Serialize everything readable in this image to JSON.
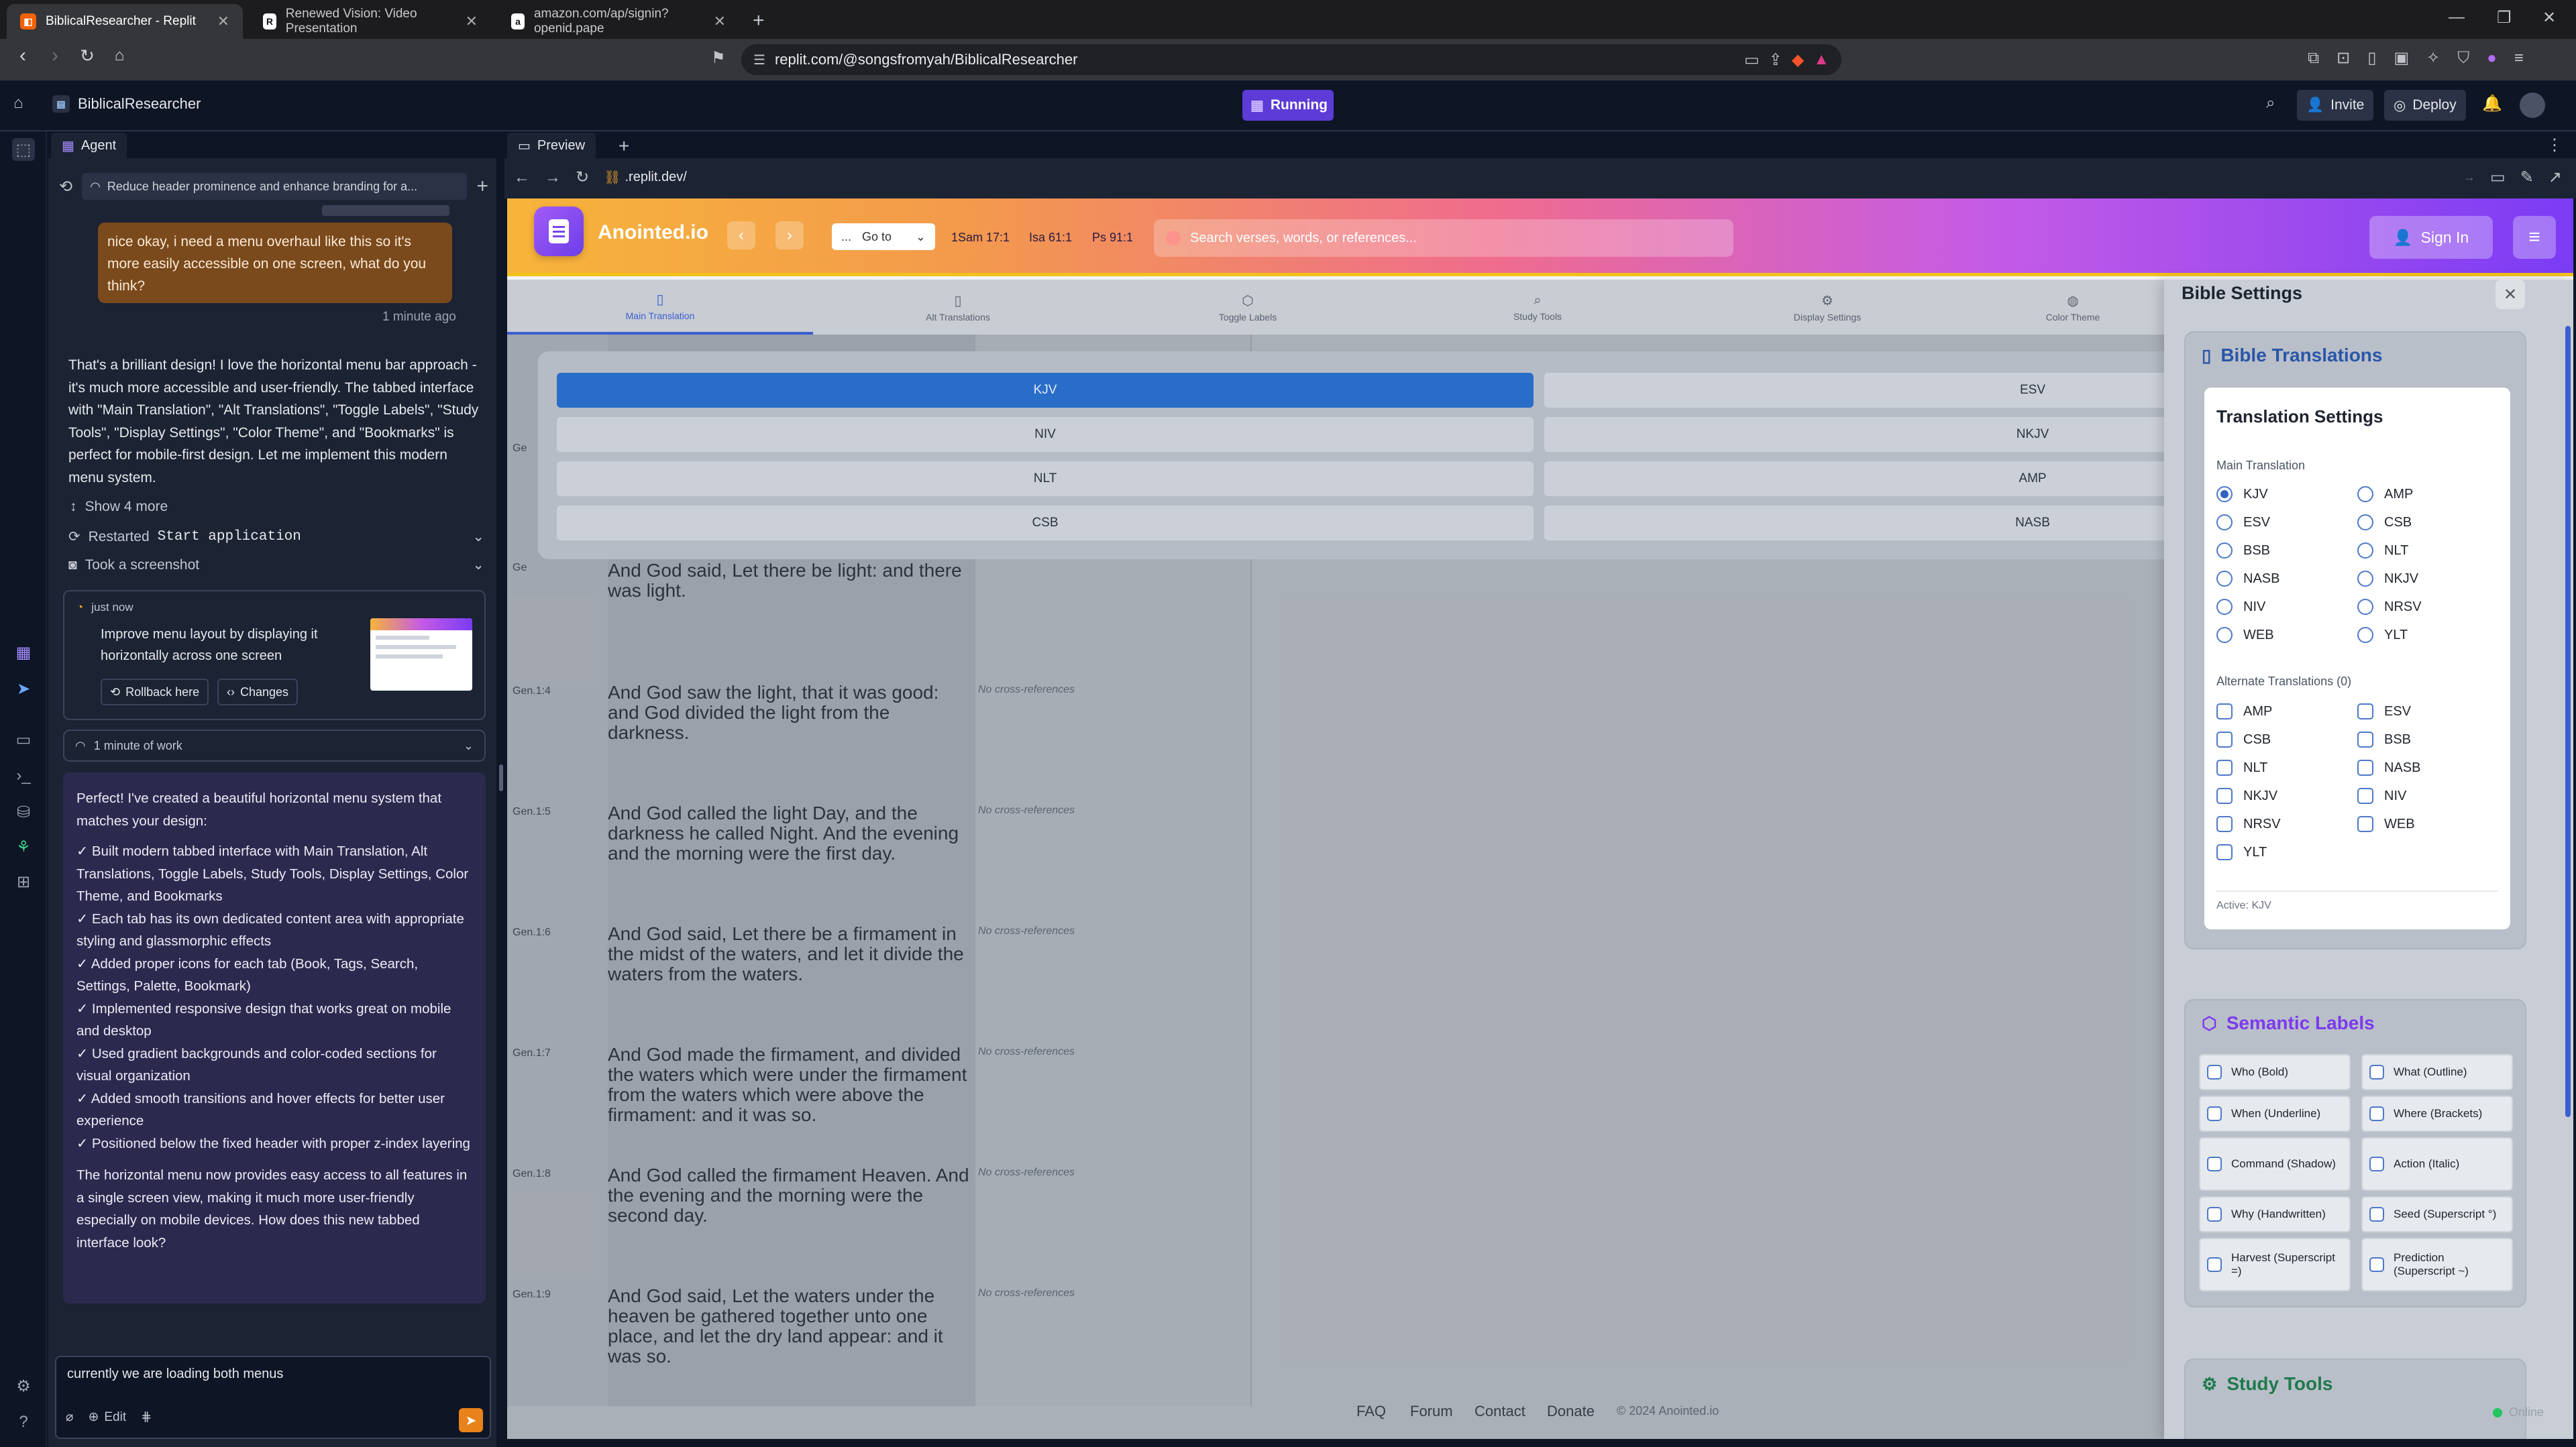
{
  "browser": {
    "tabs": [
      {
        "title": "BiblicalResearcher - Replit",
        "icon": "replit-icon",
        "active": true
      },
      {
        "title": "Renewed Vision: Video Presentation",
        "icon": "r-icon",
        "active": false
      },
      {
        "title": "amazon.com/ap/signin?openid.pape",
        "icon": "amazon-icon",
        "active": false
      }
    ],
    "url": "replit.com/@songsfromyah/BiblicalResearcher"
  },
  "replit": {
    "project_name": "BiblicalResearcher",
    "run_status": "Running",
    "invite_label": "Invite",
    "deploy_label": "Deploy"
  },
  "agent": {
    "tab_label": "Agent",
    "thread_title": "Reduce header prominence and enhance branding for a...",
    "user_message": "nice okay, i need a menu overhaul like this so it's more easily accessible on one screen, what do you think?",
    "user_time": "1 minute ago",
    "reply": "That's a brilliant design! I love the horizontal menu bar approach - it's much more accessible and user-friendly. The tabbed interface with \"Main Translation\", \"Alt Translations\", \"Toggle Labels\", \"Study Tools\", \"Display Settings\", \"Color Theme\", and \"Bookmarks\" is perfect for mobile-first design. Let me implement this modern menu system.",
    "show_more": "Show 4 more",
    "restarted_prefix": "Restarted",
    "restarted_code": "Start application",
    "screenshot": "Took a screenshot",
    "checkpoint_time": "just now",
    "checkpoint_text": "Improve menu layout by displaying it horizontally across one screen",
    "rollback_label": "Rollback here",
    "changes_label": "Changes",
    "work_label": "1 minute of work",
    "final_intro": "Perfect! I've created a beautiful horizontal menu system that matches your design:",
    "final_bullets": [
      "✓ Built modern tabbed interface with Main Translation, Alt Translations, Toggle Labels, Study Tools, Display Settings, Color Theme, and Bookmarks",
      "✓ Each tab has its own dedicated content area with appropriate styling and glassmorphic effects",
      "✓ Added proper icons for each tab (Book, Tags, Search, Settings, Palette, Bookmark)",
      "✓ Implemented responsive design that works great on mobile and desktop",
      "✓ Used gradient backgrounds and color-coded sections for visual organization",
      "✓ Added smooth transitions and hover effects for better user experience",
      "✓ Positioned below the fixed header with proper z-index layering"
    ],
    "final_outro": "The horizontal menu now provides easy access to all features in a single screen view, making it much more user-friendly especially on mobile devices. How does this new tabbed interface look?",
    "input_value": "currently we are loading both menus",
    "edit_label": "Edit"
  },
  "preview": {
    "tab_label": "Preview",
    "url": ".replit.dev/"
  },
  "site": {
    "brand": "Anointed.io",
    "goto_label": "Go to",
    "goto_prefix": "...",
    "quick_refs": [
      "1Sam 17:1",
      "Isa 61:1",
      "Ps 91:1"
    ],
    "search_placeholder": "Search verses, words, or references...",
    "signin_label": "Sign In",
    "menu_tabs": [
      "Main Translation",
      "Alt Translations",
      "Toggle Labels",
      "Study Tools",
      "Display Settings",
      "Color Theme"
    ],
    "translations_grid": [
      "KJV",
      "ESV",
      "NIV",
      "NKJV",
      "NLT",
      "AMP",
      "CSB",
      "NASB"
    ],
    "selected_translation": "KJV",
    "left_stub_a": "Ge",
    "left_stub_b": "Ge",
    "left_stub_c": "Ge",
    "verses": [
      {
        "ref": "",
        "text": "And God said, Let there be light: and there was light.",
        "xref": ""
      },
      {
        "ref": "Gen.1:4",
        "text": "And God saw the light, that it was good: and God divided the light from the darkness.",
        "xref": "No cross-references"
      },
      {
        "ref": "Gen.1:5",
        "text": "And God called the light Day, and the darkness he called Night. And the evening and the morning were the first day.",
        "xref": "No cross-references"
      },
      {
        "ref": "Gen.1:6",
        "text": "And God said, Let there be a firmament in the midst of the waters, and let it divide the waters from the waters.",
        "xref": "No cross-references"
      },
      {
        "ref": "Gen.1:7",
        "text": "And God made the firmament, and divided the waters which were under the firmament from the waters which were above the firmament: and it was so.",
        "xref": "No cross-references"
      },
      {
        "ref": "Gen.1:8",
        "text": "And God called the firmament Heaven. And the evening and the morning were the second day.",
        "xref": "No cross-references"
      },
      {
        "ref": "Gen.1:9",
        "text": "And God said, Let the waters under the heaven be gathered together unto one place, and let the dry land appear: and it was so.",
        "xref": "No cross-references"
      }
    ],
    "footer_links": [
      "FAQ",
      "Forum",
      "Contact",
      "Donate"
    ],
    "copyright": "© 2024 Anointed.io",
    "online_label": "Online"
  },
  "settings": {
    "title": "Bible Settings",
    "translations_title": "Bible Translations",
    "translation_settings": "Translation Settings",
    "main_label": "Main Translation",
    "main_options": [
      "KJV",
      "AMP",
      "ESV",
      "CSB",
      "BSB",
      "NLT",
      "NASB",
      "NKJV",
      "NIV",
      "NRSV",
      "WEB",
      "YLT"
    ],
    "main_selected": "KJV",
    "alt_label": "Alternate Translations (0)",
    "alt_options": [
      "AMP",
      "ESV",
      "CSB",
      "BSB",
      "NLT",
      "NASB",
      "NKJV",
      "NIV",
      "NRSV",
      "WEB",
      "YLT"
    ],
    "active_label": "Active: KJV",
    "semantic_title": "Semantic Labels",
    "semantic_options": [
      "Who (Bold)",
      "What (Outline)",
      "When (Underline)",
      "Where (Brackets)",
      "Command (Shadow)",
      "Action (Italic)",
      "Why (Handwritten)",
      "Seed (Superscript °)",
      "Harvest (Superscript =)",
      "Prediction (Superscript ~)"
    ],
    "study_title": "Study Tools"
  },
  "colors": {
    "accent": "#5c3bd6",
    "selected_blue": "#2a6dc9",
    "semantic_purple": "#7c3aed",
    "study_green": "#1f7a4d"
  }
}
